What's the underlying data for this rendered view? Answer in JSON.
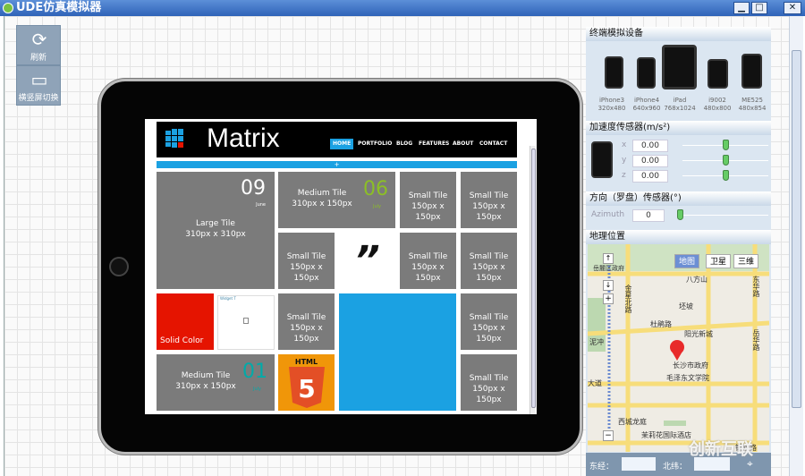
{
  "window": {
    "title": "UDE仿真模拟器",
    "minimize": "▁",
    "maximize": "□",
    "close": "✕"
  },
  "toolbar": {
    "refresh_label": "刷新",
    "rotate_label": "横竖屏切换"
  },
  "site": {
    "logo": "Matrix",
    "nav": [
      "HOME",
      "PORTFOLIO",
      "BLOG",
      "FEATURES",
      "ABOUT",
      "CONTACT"
    ],
    "expand": "+",
    "tiles": {
      "large": {
        "title": "Large Tile",
        "size": "310px x 310px",
        "date": "09",
        "month": "June",
        "date_color": "#e51400"
      },
      "medium1": {
        "title": "Medium Tile",
        "size": "310px x 150px",
        "date": "06",
        "month": "July",
        "date_color": "#8cbf26"
      },
      "medium2": {
        "title": "Medium Tile",
        "size": "310px x 150px",
        "date": "01",
        "month": "July",
        "date_color": "#00aba9"
      },
      "small": {
        "title": "Small Tile",
        "size": "150px x 150px"
      },
      "solid": "Solid Color",
      "quote": "”",
      "html5": "HTML",
      "html5_digit": "5",
      "widget": "Widget T"
    }
  },
  "panel": {
    "devices_title": "终端模拟设备",
    "devices": [
      {
        "name": "iPhone3",
        "res": "320x480"
      },
      {
        "name": "iPhone4",
        "res": "640x960"
      },
      {
        "name": "iPad",
        "res": "768x1024"
      },
      {
        "name": "i9002",
        "res": "480x800"
      },
      {
        "name": "ME525",
        "res": "480x854"
      }
    ],
    "accel_title": "加速度传感器(m/s²)",
    "accel": [
      {
        "axis": "x",
        "value": "0.00"
      },
      {
        "axis": "y",
        "value": "0.00"
      },
      {
        "axis": "z",
        "value": "0.00"
      }
    ],
    "orient_title": "方向（罗盘）传感器(°)",
    "azimuth_label": "Azimuth",
    "azimuth_value": "0",
    "geo_title": "地理位置",
    "map_types": [
      "地图",
      "卫星",
      "三维"
    ],
    "map_labels": [
      "八方山",
      "岳麓区政府",
      "金星北路",
      "坯坡",
      "杜鹃路",
      "阳光新城",
      "长沙市政府",
      "毛泽东文学院",
      "西城龙庭",
      "茉莉花国际酒店",
      "银双路",
      "东华路",
      "岳华路",
      "泥冲",
      "大道"
    ],
    "lng_label": "东经：",
    "lat_label": "北纬：",
    "lng": "",
    "lat": ""
  },
  "watermark": "创新互联"
}
